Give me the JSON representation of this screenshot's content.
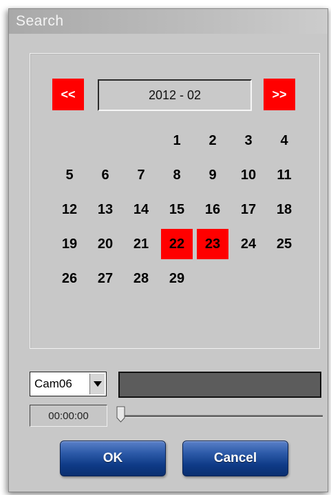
{
  "window": {
    "title": "Search"
  },
  "calendar": {
    "prev_label": "<<",
    "next_label": ">>",
    "month_label": "2012 - 02",
    "first_weekday_index": 3,
    "days": [
      "1",
      "2",
      "3",
      "4",
      "5",
      "6",
      "7",
      "8",
      "9",
      "10",
      "11",
      "12",
      "13",
      "14",
      "15",
      "16",
      "17",
      "18",
      "19",
      "20",
      "21",
      "22",
      "23",
      "24",
      "25",
      "26",
      "27",
      "28",
      "29"
    ],
    "selected_days": [
      "22",
      "23"
    ],
    "accent_color": "#ff0000"
  },
  "camera": {
    "selected": "Cam06",
    "dropdown_icon": "chevron-down-icon"
  },
  "time": {
    "value": "00:00:00",
    "slider_position": 0
  },
  "buttons": {
    "ok_label": "OK",
    "cancel_label": "Cancel"
  }
}
